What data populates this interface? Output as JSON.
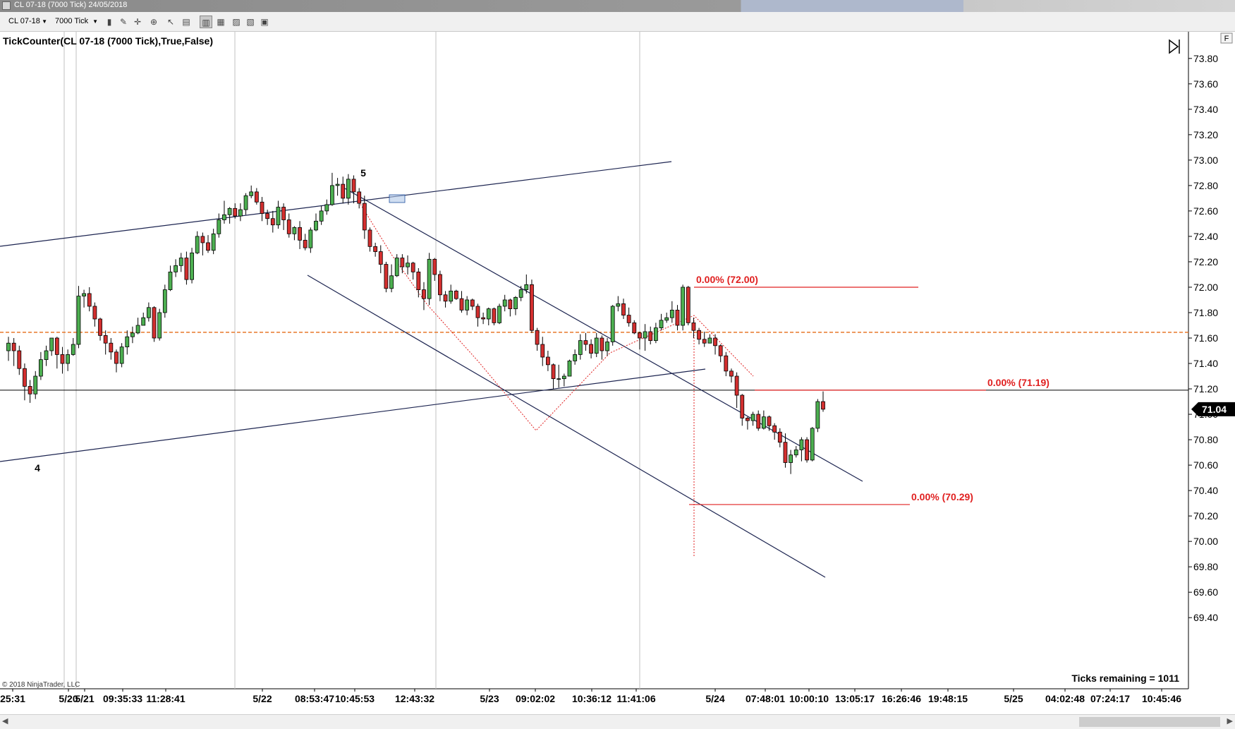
{
  "window": {
    "title": "CL 07-18 (7000 Tick)  24/05/2018",
    "instrument": "CL 07-18",
    "interval": "7000 Tick"
  },
  "chart_data": {
    "type": "candlestick",
    "indicator_label": "TickCounter(CL 07-18 (7000 Tick),True,False)",
    "y_ticks": [
      "73.80",
      "73.60",
      "73.40",
      "73.20",
      "73.00",
      "72.80",
      "72.60",
      "72.40",
      "72.20",
      "72.00",
      "71.80",
      "71.60",
      "71.40",
      "71.20",
      "71.00",
      "70.80",
      "70.60",
      "70.40",
      "70.20",
      "70.00",
      "69.80",
      "69.60",
      "69.40"
    ],
    "ylim": [
      69.35,
      73.97
    ],
    "x_ticks": [
      "25:31",
      "5/20",
      "5/21",
      "09:35:33",
      "11:28:41",
      "5/22",
      "08:53:47",
      "10:45:53",
      "12:43:32",
      "5/23",
      "09:02:02",
      "10:36:12",
      "11:41:06",
      "5/24",
      "07:48:01",
      "10:00:10",
      "13:05:17",
      "16:26:46",
      "19:48:15",
      "5/25",
      "04:02:48",
      "07:24:17",
      "10:45:46"
    ],
    "last_price": "71.04",
    "reference_line": 71.645,
    "current_line": 71.19,
    "fib_labels": [
      "0.00% (72.00)",
      "0.00% (71.19)",
      "0.00% (70.29)"
    ],
    "wave_labels": [
      "5",
      "4"
    ],
    "ticks_remaining_label": "Ticks remaining = 1011",
    "copyright": "© 2018 NinjaTrader, LLC",
    "candles": [
      [
        71.5,
        71.56,
        71.42,
        71.61
      ],
      [
        71.56,
        71.5,
        71.38,
        71.6
      ],
      [
        71.5,
        71.36,
        71.31,
        71.54
      ],
      [
        71.36,
        71.22,
        71.11,
        71.4
      ],
      [
        71.22,
        71.16,
        71.09,
        71.27
      ],
      [
        71.16,
        71.3,
        71.12,
        71.34
      ],
      [
        71.3,
        71.43,
        71.27,
        71.49
      ],
      [
        71.43,
        71.5,
        71.38,
        71.54
      ],
      [
        71.5,
        71.6,
        71.46,
        71.6
      ],
      [
        71.6,
        71.47,
        71.36,
        71.61
      ],
      [
        71.47,
        71.4,
        71.32,
        71.53
      ],
      [
        71.4,
        71.47,
        71.34,
        71.51
      ],
      [
        71.47,
        71.55,
        71.46,
        71.6
      ],
      [
        71.55,
        71.93,
        71.52,
        72.01
      ],
      [
        71.93,
        71.95,
        71.84,
        71.98
      ],
      [
        71.95,
        71.85,
        71.81,
        72.0
      ],
      [
        71.85,
        71.75,
        71.69,
        71.88
      ],
      [
        71.75,
        71.62,
        71.58,
        71.76
      ],
      [
        71.62,
        71.56,
        71.47,
        71.66
      ],
      [
        71.56,
        71.49,
        71.43,
        71.6
      ],
      [
        71.49,
        71.4,
        71.33,
        71.51
      ],
      [
        71.4,
        71.53,
        71.37,
        71.56
      ],
      [
        71.53,
        71.61,
        71.47,
        71.66
      ],
      [
        71.61,
        71.64,
        71.56,
        71.69
      ],
      [
        71.64,
        71.7,
        71.63,
        71.76
      ],
      [
        71.7,
        71.76,
        71.7,
        71.8
      ],
      [
        71.76,
        71.84,
        71.73,
        71.88
      ],
      [
        71.84,
        71.6,
        71.57,
        71.85
      ],
      [
        71.6,
        71.8,
        71.58,
        71.83
      ],
      [
        71.8,
        71.98,
        71.76,
        72.02
      ],
      [
        71.98,
        72.12,
        71.97,
        72.17
      ],
      [
        72.12,
        72.17,
        72.08,
        72.22
      ],
      [
        72.17,
        72.23,
        72.12,
        72.27
      ],
      [
        72.23,
        72.06,
        72.02,
        72.28
      ],
      [
        72.06,
        72.27,
        72.03,
        72.31
      ],
      [
        72.27,
        72.4,
        72.26,
        72.44
      ],
      [
        72.4,
        72.35,
        72.25,
        72.43
      ],
      [
        72.35,
        72.29,
        72.27,
        72.41
      ],
      [
        72.29,
        72.42,
        72.26,
        72.46
      ],
      [
        72.42,
        72.53,
        72.39,
        72.58
      ],
      [
        72.53,
        72.57,
        72.5,
        72.68
      ],
      [
        72.57,
        72.62,
        72.5,
        72.63
      ],
      [
        72.62,
        72.56,
        72.54,
        72.66
      ],
      [
        72.56,
        72.61,
        72.52,
        72.66
      ],
      [
        72.61,
        72.72,
        72.57,
        72.74
      ],
      [
        72.72,
        72.75,
        72.7,
        72.8
      ],
      [
        72.75,
        72.67,
        72.65,
        72.78
      ],
      [
        72.67,
        72.58,
        72.52,
        72.71
      ],
      [
        72.58,
        72.54,
        72.49,
        72.61
      ],
      [
        72.54,
        72.49,
        72.43,
        72.6
      ],
      [
        72.49,
        72.63,
        72.46,
        72.68
      ],
      [
        72.63,
        72.53,
        72.45,
        72.66
      ],
      [
        72.53,
        72.42,
        72.39,
        72.58
      ],
      [
        72.42,
        72.47,
        72.37,
        72.48
      ],
      [
        72.47,
        72.37,
        72.3,
        72.52
      ],
      [
        72.37,
        72.31,
        72.29,
        72.42
      ],
      [
        72.31,
        72.45,
        72.27,
        72.47
      ],
      [
        72.45,
        72.52,
        72.44,
        72.58
      ],
      [
        72.52,
        72.6,
        72.49,
        72.64
      ],
      [
        72.6,
        72.65,
        72.57,
        72.69
      ],
      [
        72.65,
        72.8,
        72.64,
        72.9
      ],
      [
        72.8,
        72.81,
        72.72,
        72.86
      ],
      [
        72.81,
        72.7,
        72.66,
        72.87
      ],
      [
        72.7,
        72.85,
        72.65,
        72.89
      ],
      [
        72.85,
        72.75,
        72.66,
        72.88
      ],
      [
        72.75,
        72.66,
        72.62,
        72.78
      ],
      [
        72.66,
        72.45,
        72.38,
        72.72
      ],
      [
        72.45,
        72.32,
        72.28,
        72.47
      ],
      [
        72.32,
        72.28,
        72.24,
        72.35
      ],
      [
        72.28,
        72.18,
        72.11,
        72.33
      ],
      [
        72.18,
        71.99,
        71.96,
        72.2
      ],
      [
        71.99,
        72.09,
        71.96,
        72.18
      ],
      [
        72.09,
        72.23,
        72.08,
        72.26
      ],
      [
        72.23,
        72.16,
        72.11,
        72.26
      ],
      [
        72.16,
        72.19,
        72.1,
        72.25
      ],
      [
        72.19,
        72.12,
        72.06,
        72.2
      ],
      [
        72.12,
        71.98,
        71.92,
        72.15
      ],
      [
        71.98,
        71.91,
        71.82,
        72.04
      ],
      [
        71.91,
        72.22,
        71.86,
        72.27
      ],
      [
        72.22,
        72.1,
        72.05,
        72.23
      ],
      [
        72.1,
        71.94,
        71.89,
        72.13
      ],
      [
        71.94,
        71.89,
        71.84,
        71.97
      ],
      [
        71.89,
        71.97,
        71.87,
        72.02
      ],
      [
        71.97,
        71.91,
        71.9,
        71.98
      ],
      [
        71.91,
        71.82,
        71.8,
        71.97
      ],
      [
        71.82,
        71.9,
        71.78,
        71.93
      ],
      [
        71.9,
        71.85,
        71.82,
        71.91
      ],
      [
        71.85,
        71.76,
        71.69,
        71.87
      ],
      [
        71.76,
        71.75,
        71.71,
        71.8
      ],
      [
        71.75,
        71.83,
        71.7,
        71.84
      ],
      [
        71.83,
        71.72,
        71.7,
        71.84
      ],
      [
        71.72,
        71.85,
        71.71,
        71.87
      ],
      [
        71.85,
        71.9,
        71.81,
        71.94
      ],
      [
        71.9,
        71.83,
        71.77,
        71.91
      ],
      [
        71.83,
        71.92,
        71.78,
        71.93
      ],
      [
        71.92,
        71.98,
        71.89,
        72.01
      ],
      [
        71.98,
        72.02,
        71.95,
        72.1
      ],
      [
        72.02,
        71.66,
        71.64,
        72.06
      ],
      [
        71.66,
        71.55,
        71.5,
        71.68
      ],
      [
        71.55,
        71.45,
        71.38,
        71.61
      ],
      [
        71.45,
        71.39,
        71.34,
        71.5
      ],
      [
        71.39,
        71.28,
        71.2,
        71.4
      ],
      [
        71.28,
        71.28,
        71.21,
        71.39
      ],
      [
        71.28,
        71.3,
        71.22,
        71.32
      ],
      [
        71.3,
        71.42,
        71.3,
        71.43
      ],
      [
        71.42,
        71.47,
        71.39,
        71.51
      ],
      [
        71.47,
        71.58,
        71.43,
        71.63
      ],
      [
        71.58,
        71.55,
        71.5,
        71.64
      ],
      [
        71.55,
        71.48,
        71.44,
        71.59
      ],
      [
        71.48,
        71.6,
        71.45,
        71.64
      ],
      [
        71.6,
        71.5,
        71.43,
        71.62
      ],
      [
        71.5,
        71.57,
        71.46,
        71.6
      ],
      [
        71.57,
        71.85,
        71.54,
        71.86
      ],
      [
        71.85,
        71.87,
        71.81,
        71.93
      ],
      [
        71.87,
        71.78,
        71.75,
        71.91
      ],
      [
        71.78,
        71.72,
        71.69,
        71.84
      ],
      [
        71.72,
        71.64,
        71.63,
        71.74
      ],
      [
        71.64,
        71.6,
        71.51,
        71.65
      ],
      [
        71.6,
        71.65,
        71.5,
        71.71
      ],
      [
        71.65,
        71.58,
        71.55,
        71.69
      ],
      [
        71.58,
        71.68,
        71.56,
        71.72
      ],
      [
        71.68,
        71.74,
        71.66,
        71.79
      ],
      [
        71.74,
        71.76,
        71.72,
        71.8
      ],
      [
        71.76,
        71.82,
        71.72,
        71.89
      ],
      [
        71.82,
        71.7,
        71.66,
        71.86
      ],
      [
        71.7,
        72.0,
        71.66,
        72.02
      ],
      [
        72.0,
        71.72,
        71.7,
        72.01
      ],
      [
        71.72,
        71.66,
        71.6,
        71.76
      ],
      [
        71.66,
        71.59,
        71.55,
        71.68
      ],
      [
        71.59,
        71.56,
        71.53,
        71.65
      ],
      [
        71.56,
        71.6,
        71.56,
        71.63
      ],
      [
        71.6,
        71.54,
        71.47,
        71.63
      ],
      [
        71.54,
        71.46,
        71.41,
        71.55
      ],
      [
        71.46,
        71.34,
        71.3,
        71.49
      ],
      [
        71.34,
        71.3,
        71.25,
        71.36
      ],
      [
        71.3,
        71.15,
        71.05,
        71.33
      ],
      [
        71.15,
        70.97,
        70.91,
        71.16
      ],
      [
        70.97,
        70.95,
        70.88,
        70.98
      ],
      [
        70.95,
        71.0,
        70.91,
        71.02
      ],
      [
        71.0,
        70.89,
        70.87,
        71.03
      ],
      [
        70.89,
        70.98,
        70.88,
        71.03
      ],
      [
        70.98,
        70.91,
        70.87,
        70.99
      ],
      [
        70.91,
        70.86,
        70.8,
        70.93
      ],
      [
        70.86,
        70.78,
        70.74,
        70.89
      ],
      [
        70.78,
        70.62,
        70.58,
        70.85
      ],
      [
        70.62,
        70.68,
        70.53,
        70.72
      ],
      [
        70.68,
        70.72,
        70.66,
        70.75
      ],
      [
        70.72,
        70.8,
        70.63,
        70.82
      ],
      [
        70.8,
        70.64,
        70.62,
        70.82
      ],
      [
        70.64,
        70.89,
        70.63,
        70.9
      ],
      [
        70.89,
        71.1,
        70.86,
        71.12
      ],
      [
        71.1,
        71.04,
        71.02,
        71.18
      ]
    ]
  }
}
